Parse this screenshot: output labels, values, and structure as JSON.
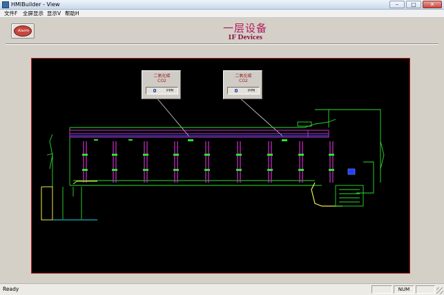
{
  "window": {
    "title": "HMIBuilder - View",
    "minimize_glyph": "–",
    "maximize_glyph": "□",
    "close_glyph": "✕"
  },
  "menu": {
    "items": [
      {
        "label": "文件F"
      },
      {
        "label": "全屏显示"
      },
      {
        "label": "显示V"
      },
      {
        "label": "帮助H"
      }
    ]
  },
  "header": {
    "alarm_label": "Alarm",
    "title_cn": "一层设备",
    "title_en": "1F Devices"
  },
  "sensors": [
    {
      "name": "二氧化碳",
      "code": "CO2",
      "value": "0",
      "unit": "PPM"
    },
    {
      "name": "二氧化碳",
      "code": "CO2",
      "value": "0",
      "unit": "PPM"
    }
  ],
  "status": {
    "text": "Ready",
    "num": "NUM"
  },
  "colors": {
    "canvas_bg": "#000000",
    "canvas_border": "#c02020",
    "title": "#b3195a",
    "pipe_green": "#2ee02e",
    "beam_magenta": "#d030d0",
    "line_blue": "#3050ff",
    "accent_yellow": "#f0f040",
    "cyan": "#20e0e0"
  },
  "icons": {
    "app": "app-icon",
    "alarm": "alarm-icon"
  }
}
